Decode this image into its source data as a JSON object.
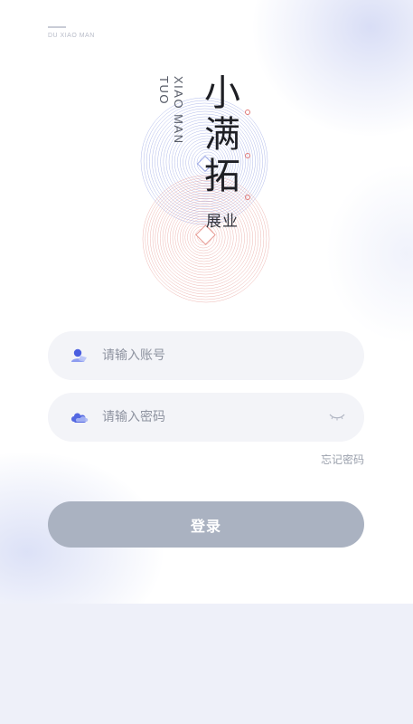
{
  "brand": {
    "small_label": "DU XIAO MAN",
    "en_vertical_line1": "XIAO MAN",
    "en_vertical_line2": "TUO",
    "cn_char1": "小",
    "cn_char2": "满",
    "cn_char3": "拓",
    "cn_sub": "展业"
  },
  "login_form": {
    "account_placeholder": "请输入账号",
    "password_placeholder": "请输入密码",
    "forgot_password": "忘记密码",
    "login_button": "登录"
  },
  "colors": {
    "accent_blue": "#5b6fe0",
    "accent_red": "#e07a78",
    "button_disabled": "#aab2c1",
    "input_bg": "#f3f4f8"
  },
  "icons": {
    "account": "user-icon",
    "password": "cloud-lock-icon",
    "toggle_visibility": "eye-closed-icon"
  }
}
